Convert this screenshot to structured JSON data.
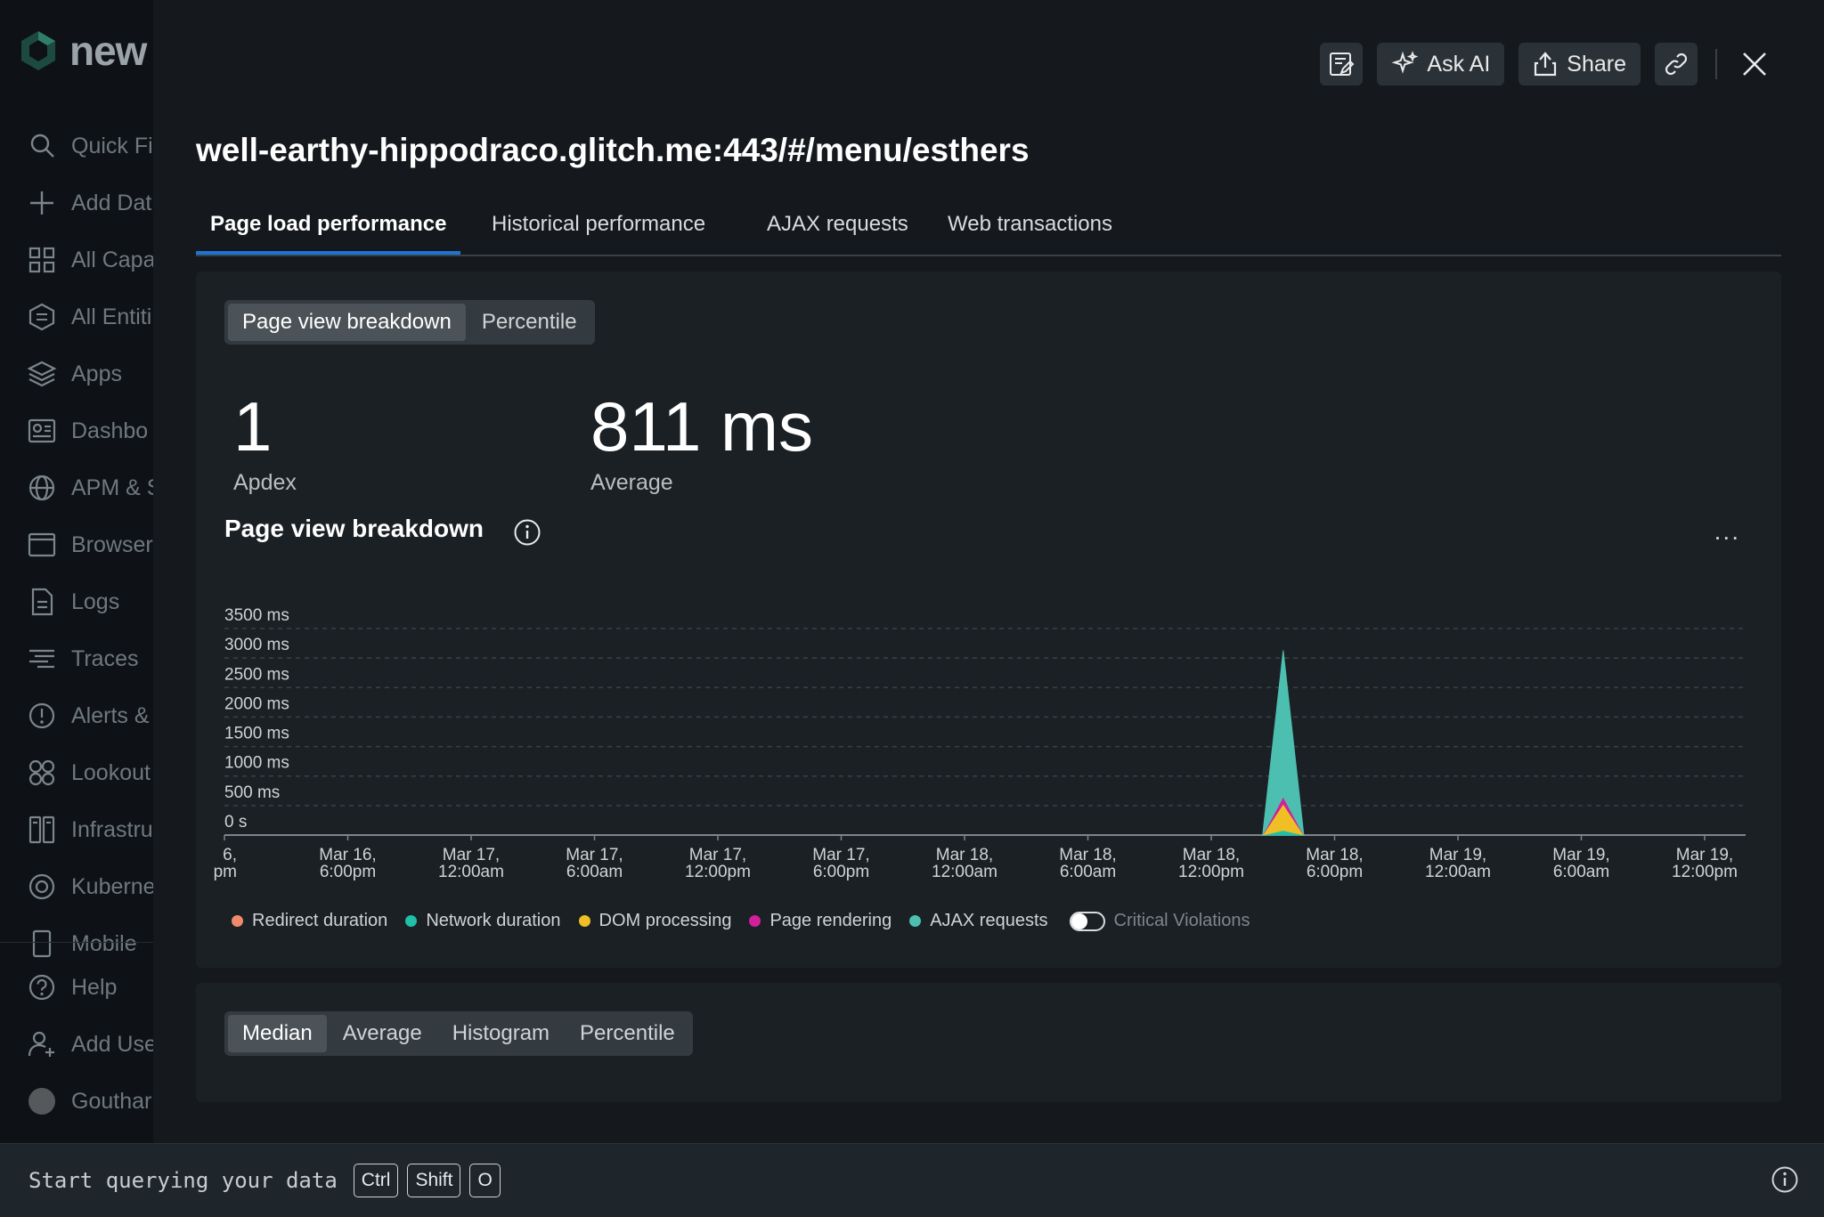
{
  "app": {
    "brand": "new"
  },
  "nav": {
    "items": [
      {
        "label": "Quick Fi",
        "icon": "search-icon"
      },
      {
        "label": "Add Dat",
        "icon": "plus-icon"
      },
      {
        "label": "All Capa",
        "icon": "grid-icon"
      },
      {
        "label": "All Entiti",
        "icon": "entities-icon"
      },
      {
        "label": "Apps",
        "icon": "layers-icon"
      },
      {
        "label": "Dashbo",
        "icon": "dashboard-icon"
      },
      {
        "label": "APM & S",
        "icon": "globe-icon"
      },
      {
        "label": "Browser",
        "icon": "browser-icon"
      },
      {
        "label": "Logs",
        "icon": "document-icon"
      },
      {
        "label": "Traces",
        "icon": "traces-icon"
      },
      {
        "label": "Alerts &",
        "icon": "alert-icon"
      },
      {
        "label": "Lookout",
        "icon": "lookout-icon"
      },
      {
        "label": "Infrastru",
        "icon": "infrastructure-icon"
      },
      {
        "label": "Kuberne",
        "icon": "kubernetes-icon"
      },
      {
        "label": "Mobile",
        "icon": "mobile-icon"
      }
    ],
    "bottom": [
      {
        "label": "Help",
        "icon": "help-icon"
      },
      {
        "label": "Add Use",
        "icon": "add-user-icon"
      },
      {
        "label": "Gouthar",
        "icon": "avatar"
      }
    ]
  },
  "modal": {
    "actions": {
      "ask_ai": "Ask AI",
      "share": "Share"
    },
    "title": "well-earthy-hippodraco.glitch.me:443/#/menu/esthers",
    "tabs": [
      "Page load performance",
      "Historical performance",
      "AJAX requests",
      "Web transactions"
    ],
    "active_tab": 0,
    "segment1": {
      "options": [
        "Page view breakdown",
        "Percentile"
      ],
      "active": 0
    },
    "kpis": [
      {
        "value": "1",
        "label": "Apdex"
      },
      {
        "value": "811 ms",
        "label": "Average"
      }
    ],
    "chart_title": "Page view breakdown",
    "more": "...",
    "legend": [
      {
        "name": "Redirect duration",
        "color": "#f08a6b"
      },
      {
        "name": "Network duration",
        "color": "#1fbfa8"
      },
      {
        "name": "DOM processing",
        "color": "#f0be25"
      },
      {
        "name": "Page rendering",
        "color": "#d0209c"
      },
      {
        "name": "AJAX requests",
        "color": "#4cbfb0"
      }
    ],
    "critical_violations": "Critical Violations",
    "segment2": {
      "options": [
        "Median",
        "Average",
        "Histogram",
        "Percentile"
      ],
      "active": 0
    }
  },
  "chart_data": {
    "type": "area",
    "stacked": true,
    "y_ticks": [
      "3500 ms",
      "3000 ms",
      "2500 ms",
      "2000 ms",
      "1500 ms",
      "1000 ms",
      "500 ms",
      "0 s"
    ],
    "ylim": [
      0,
      3500
    ],
    "x_ticks": [
      [
        "6,",
        "pm"
      ],
      [
        "Mar 16,",
        "6:00pm"
      ],
      [
        "Mar 17,",
        "12:00am"
      ],
      [
        "Mar 17,",
        "6:00am"
      ],
      [
        "Mar 17,",
        "12:00pm"
      ],
      [
        "Mar 17,",
        "6:00pm"
      ],
      [
        "Mar 18,",
        "12:00am"
      ],
      [
        "Mar 18,",
        "6:00am"
      ],
      [
        "Mar 18,",
        "12:00pm"
      ],
      [
        "Mar 18,",
        "6:00pm"
      ],
      [
        "Mar 19,",
        "12:00am"
      ],
      [
        "Mar 19,",
        "6:00am"
      ],
      [
        "Mar 19,",
        "12:00pm"
      ]
    ],
    "x_hours_from_first_tick": [
      0,
      6,
      12,
      18,
      24,
      30,
      36,
      42,
      48,
      54,
      60,
      66,
      72
    ],
    "grid": true,
    "legend_position": "bottom",
    "series": [
      {
        "name": "Network duration",
        "color": "#1fbfa8",
        "x": [
          50.5,
          51.5,
          52.5
        ],
        "values": [
          0,
          80,
          0
        ]
      },
      {
        "name": "DOM processing",
        "color": "#f0be25",
        "x": [
          50.5,
          51.5,
          52.5
        ],
        "values": [
          0,
          450,
          0
        ]
      },
      {
        "name": "Page rendering",
        "color": "#d0209c",
        "x": [
          50.5,
          51.5,
          52.5
        ],
        "values": [
          0,
          120,
          0
        ]
      },
      {
        "name": "AJAX requests",
        "color": "#4cbfb0",
        "x": [
          50.5,
          51.5,
          52.5
        ],
        "values": [
          0,
          2480,
          0
        ]
      }
    ]
  },
  "querybar": {
    "text": "Start querying your data",
    "keys": [
      "Ctrl",
      "Shift",
      "O"
    ]
  }
}
